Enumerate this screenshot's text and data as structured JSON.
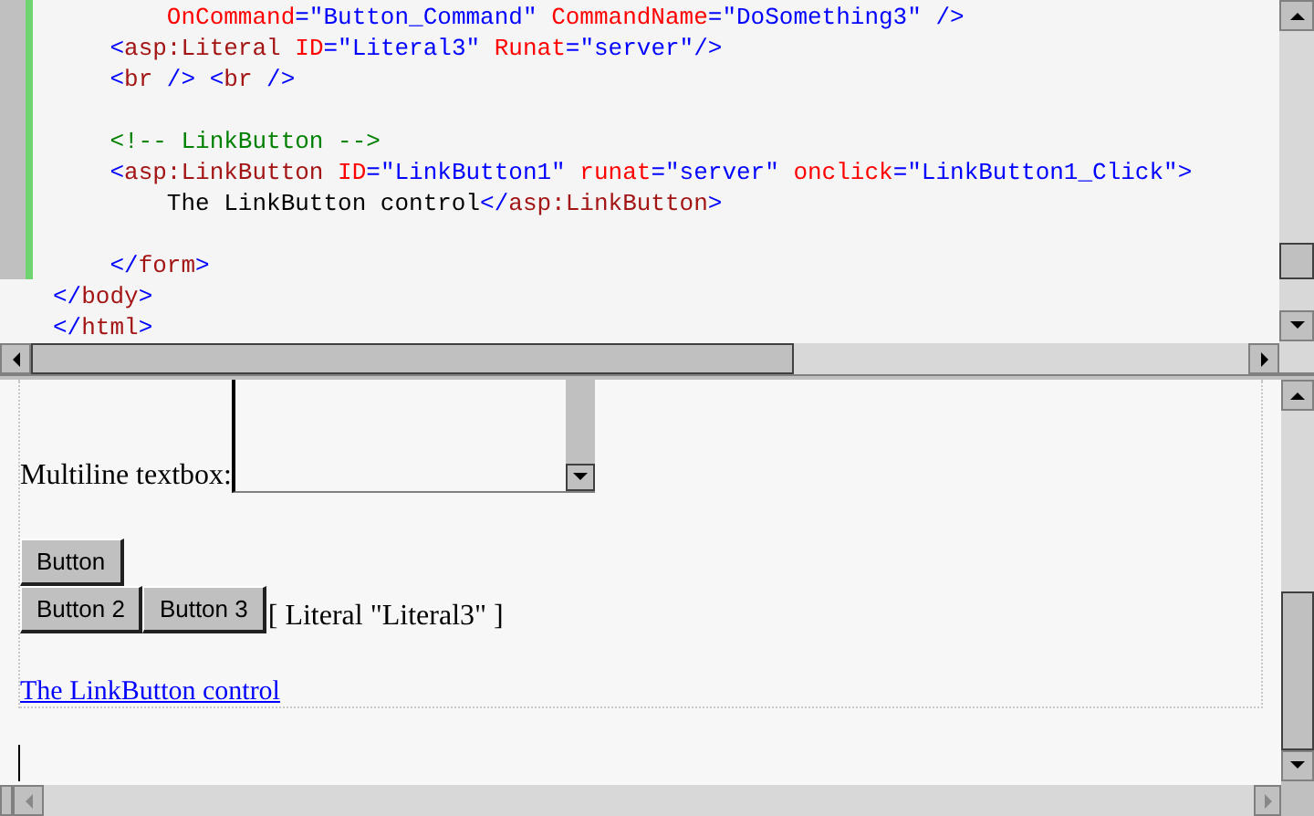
{
  "source_view": {
    "lines": [
      {
        "kind": "code",
        "tokens": [
          {
            "kind": "attr",
            "text": "        OnCommand"
          },
          {
            "kind": "punct",
            "text": "=\"Button_Command\" "
          },
          {
            "kind": "attr",
            "text": "CommandName"
          },
          {
            "kind": "punct",
            "text": "=\"DoSomething3\" />"
          }
        ]
      },
      {
        "kind": "code",
        "tokens": [
          {
            "kind": "punct",
            "text": "    <"
          },
          {
            "kind": "tag",
            "text": "asp:Literal"
          },
          {
            "kind": "attr",
            "text": " ID"
          },
          {
            "kind": "punct",
            "text": "=\"Literal3\" "
          },
          {
            "kind": "attr",
            "text": "Runat"
          },
          {
            "kind": "punct",
            "text": "=\"server\"/>"
          }
        ]
      },
      {
        "kind": "code",
        "tokens": [
          {
            "kind": "punct",
            "text": "    <"
          },
          {
            "kind": "tag",
            "text": "br"
          },
          {
            "kind": "punct",
            "text": " /> <"
          },
          {
            "kind": "tag",
            "text": "br"
          },
          {
            "kind": "punct",
            "text": " />"
          }
        ]
      },
      {
        "kind": "blank"
      },
      {
        "kind": "code",
        "tokens": [
          {
            "kind": "comment",
            "text": "    <!-- LinkButton -->"
          }
        ]
      },
      {
        "kind": "code",
        "tokens": [
          {
            "kind": "punct",
            "text": "    <"
          },
          {
            "kind": "tag",
            "text": "asp:LinkButton"
          },
          {
            "kind": "attr",
            "text": " ID"
          },
          {
            "kind": "punct",
            "text": "=\"LinkButton1\" "
          },
          {
            "kind": "attr",
            "text": "runat"
          },
          {
            "kind": "punct",
            "text": "=\"server\" "
          },
          {
            "kind": "attr",
            "text": "onclick"
          },
          {
            "kind": "punct",
            "text": "=\"LinkButton1_Click\">"
          }
        ]
      },
      {
        "kind": "code",
        "tokens": [
          {
            "kind": "text",
            "text": "        The LinkButton control"
          },
          {
            "kind": "punct",
            "text": "</"
          },
          {
            "kind": "tag",
            "text": "asp:LinkButton"
          },
          {
            "kind": "punct",
            "text": ">"
          }
        ]
      },
      {
        "kind": "blank"
      },
      {
        "kind": "code",
        "tokens": [
          {
            "kind": "punct",
            "text": "    </"
          },
          {
            "kind": "tag",
            "text": "form"
          },
          {
            "kind": "punct",
            "text": ">"
          }
        ]
      },
      {
        "kind": "code",
        "tokens": [
          {
            "kind": "punct",
            "text": "</"
          },
          {
            "kind": "tag",
            "text": "body"
          },
          {
            "kind": "punct",
            "text": ">"
          }
        ]
      },
      {
        "kind": "code",
        "tokens": [
          {
            "kind": "punct",
            "text": "</"
          },
          {
            "kind": "tag",
            "text": "html"
          },
          {
            "kind": "punct",
            "text": ">"
          }
        ]
      }
    ]
  },
  "design_view": {
    "textbox_label": "Multiline textbox:",
    "buttons": [
      [
        "Button"
      ],
      [
        "Button 2",
        "Button 3"
      ]
    ],
    "literal": "[ Literal \"Literal3\" ]",
    "link": "The LinkButton control"
  }
}
